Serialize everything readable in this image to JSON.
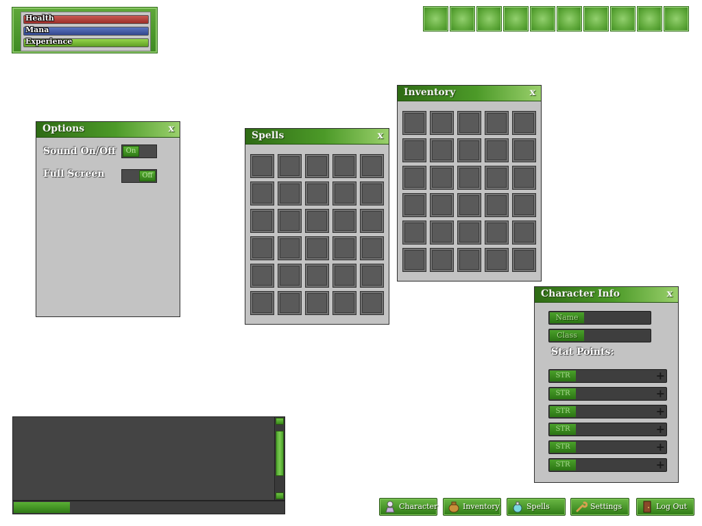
{
  "status": {
    "health_label": "Health",
    "mana_label": "Mana",
    "experience_label": "Experience",
    "colors": {
      "health": "#b53a35",
      "mana": "#3f58a8",
      "experience": "#7cc232"
    }
  },
  "hotbar": {
    "slot_count": 10
  },
  "options": {
    "title": "Options",
    "close": "x",
    "sound_label": "Sound On/Off",
    "sound_state": "On",
    "fullscreen_label": "Full Screen",
    "fullscreen_state": "Off"
  },
  "spells": {
    "title": "Spells",
    "close": "x",
    "rows": 6,
    "cols": 5
  },
  "inventory": {
    "title": "Inventory",
    "close": "x",
    "rows": 6,
    "cols": 5
  },
  "character": {
    "title": "Character Info",
    "close": "x",
    "name_label": "Name",
    "class_label": "Class",
    "stat_points_label": "Stat Points:",
    "stats": [
      "STR",
      "STR",
      "STR",
      "STR",
      "STR",
      "STR"
    ],
    "plus": "+"
  },
  "menu": {
    "character": "Character",
    "inventory": "Inventory",
    "spells": "Spells",
    "settings": "Settings",
    "logout": "Log Out"
  }
}
